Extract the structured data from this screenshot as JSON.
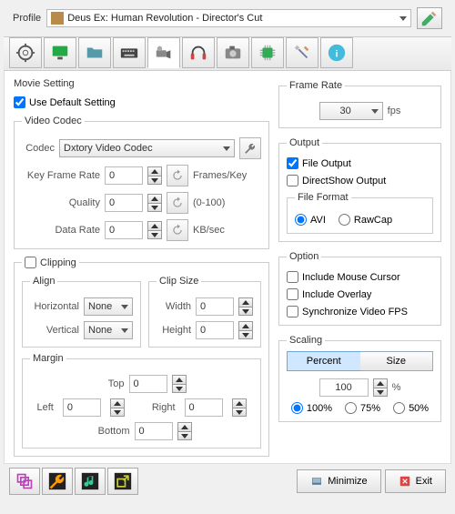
{
  "profile": {
    "label": "Profile",
    "selected": "Deus Ex: Human Revolution - Director's Cut"
  },
  "movie": {
    "title": "Movie Setting",
    "use_default": "Use Default Setting",
    "codec_group": "Video Codec",
    "codec_label": "Codec",
    "codec_value": "Dxtory Video Codec",
    "keyframe_label": "Key Frame Rate",
    "keyframe_value": "0",
    "keyframe_unit": "Frames/Key",
    "quality_label": "Quality",
    "quality_value": "0",
    "quality_unit": "(0-100)",
    "datarate_label": "Data Rate",
    "datarate_value": "0",
    "datarate_unit": "KB/sec"
  },
  "clipping": {
    "title": "Clipping",
    "align": "Align",
    "h_label": "Horizontal",
    "h_value": "None",
    "v_label": "Vertical",
    "v_value": "None",
    "clipsize": "Clip Size",
    "w_label": "Width",
    "w_value": "0",
    "h2_label": "Height",
    "h2_value": "0",
    "margin": "Margin",
    "top": "Top",
    "top_v": "0",
    "left": "Left",
    "left_v": "0",
    "right": "Right",
    "right_v": "0",
    "bottom": "Bottom",
    "bottom_v": "0"
  },
  "framerate": {
    "title": "Frame Rate",
    "value": "30",
    "unit": "fps"
  },
  "output": {
    "title": "Output",
    "file": "File Output",
    "ds": "DirectShow Output",
    "fileformat": "File Format",
    "avi": "AVI",
    "rawcap": "RawCap"
  },
  "option": {
    "title": "Option",
    "mouse": "Include Mouse Cursor",
    "overlay": "Include Overlay",
    "sync": "Synchronize Video FPS"
  },
  "scaling": {
    "title": "Scaling",
    "percent": "Percent",
    "size": "Size",
    "value": "100",
    "unit": "%",
    "r100": "100%",
    "r75": "75%",
    "r50": "50%"
  },
  "footer": {
    "minimize": "Minimize",
    "exit": "Exit"
  }
}
